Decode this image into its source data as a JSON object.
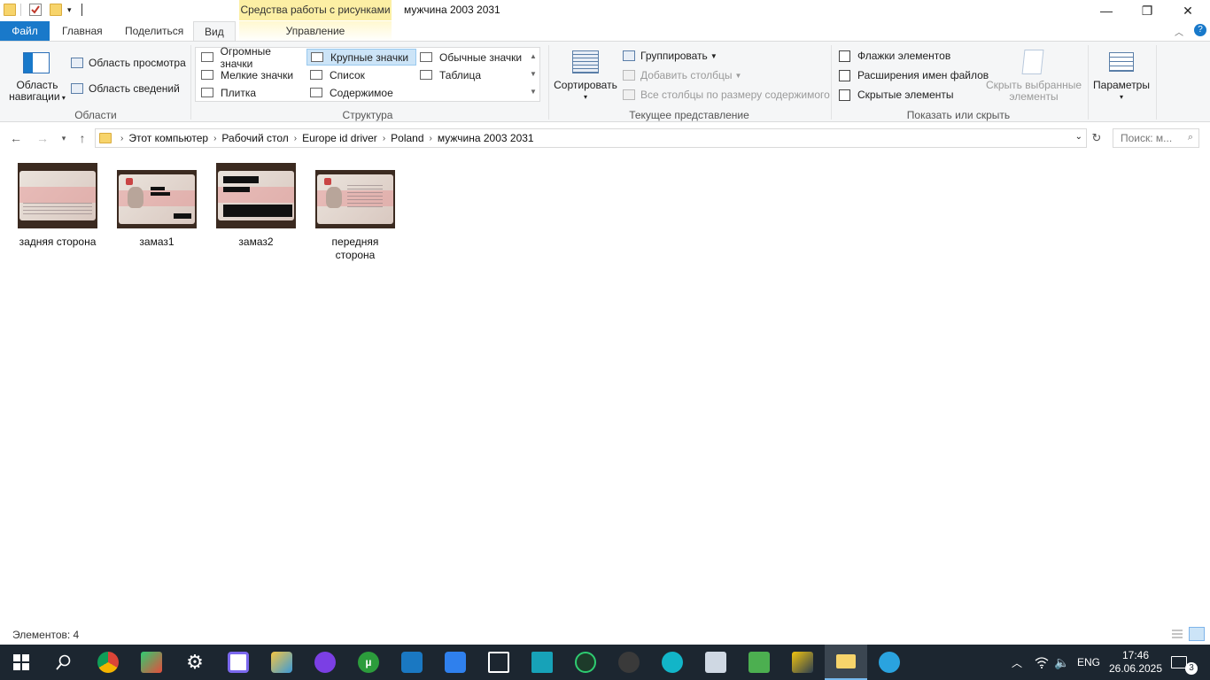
{
  "window": {
    "title": "мужчина 2003 2031",
    "context_tab_header": "Средства работы с рисунками",
    "controls": {
      "minimize": "—",
      "restore": "❐",
      "close": "✕"
    }
  },
  "tabs": {
    "file": "Файл",
    "home": "Главная",
    "share": "Поделиться",
    "view": "Вид",
    "manage": "Управление"
  },
  "ribbon": {
    "panes": {
      "nav_pane": "Область навигации",
      "preview_pane": "Область просмотра",
      "details_pane": "Область сведений",
      "group_label": "Области"
    },
    "layout": {
      "options": [
        "Огромные значки",
        "Крупные значки",
        "Обычные значки",
        "Мелкие значки",
        "Список",
        "Таблица",
        "Плитка",
        "Содержимое"
      ],
      "selected": "Крупные значки",
      "group_label": "Структура"
    },
    "current_view": {
      "sort": "Сортировать",
      "group_by": "Группировать",
      "add_columns": "Добавить столбцы",
      "size_columns": "Все столбцы по размеру содержимого",
      "group_label": "Текущее представление"
    },
    "show_hide": {
      "item_checkboxes": "Флажки элементов",
      "file_extensions": "Расширения имен файлов",
      "hidden_items": "Скрытые элементы",
      "hide_selected": "Скрыть выбранные элементы",
      "group_label": "Показать или скрыть"
    },
    "options": "Параметры"
  },
  "address": {
    "crumbs": [
      "Этот компьютер",
      "Рабочий стол",
      "Europe id driver",
      "Poland",
      "мужчина 2003 2031"
    ],
    "search_placeholder": "Поиск: м..."
  },
  "files": [
    {
      "name": "задняя сторона"
    },
    {
      "name": "замаз1"
    },
    {
      "name": "замаз2"
    },
    {
      "name": "передняя сторона"
    }
  ],
  "status": {
    "item_count": "Элементов: 4"
  },
  "taskbar": {
    "language": "ENG",
    "time": "17:46",
    "date": "26.06.2025",
    "notifications": "3"
  },
  "colors": {
    "accent": "#1979ca",
    "context_tab": "#fcefa4",
    "taskbar": "#1c2630",
    "selection": "#cce4f7"
  }
}
